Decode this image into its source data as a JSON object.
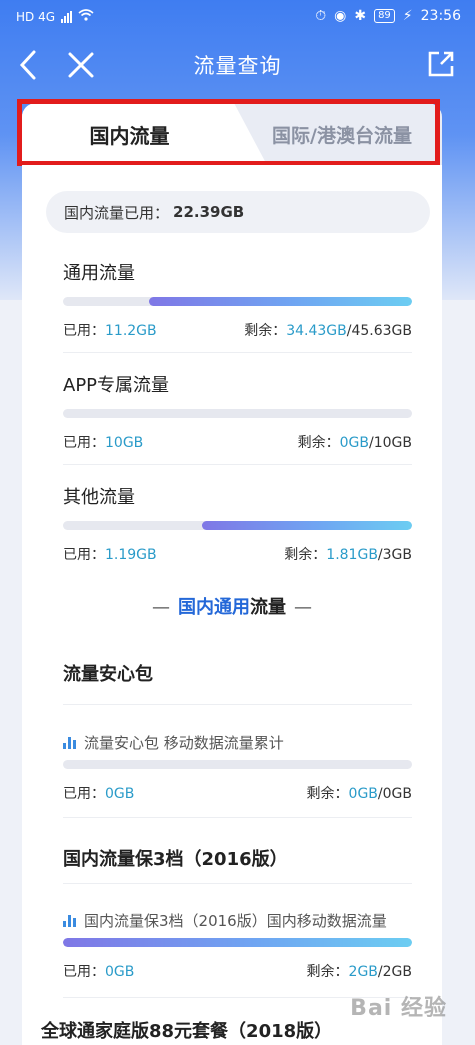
{
  "statusbar": {
    "network": "HD 4G",
    "battery": "89",
    "time": "23:56"
  },
  "nav": {
    "title": "流量查询"
  },
  "tabs": {
    "active": "国内流量",
    "inactive": "国际/港澳台流量"
  },
  "summary": {
    "label": "国内流量已用：",
    "value": "22.39GB"
  },
  "usage": [
    {
      "title": "通用流量",
      "used_label": "已用：",
      "used": "11.2GB",
      "remain_label": "剩余：",
      "remain": "34.43GB",
      "total": "/45.63GB",
      "remaining_fraction": 0.755
    },
    {
      "title": "APP专属流量",
      "used_label": "已用：",
      "used": "10GB",
      "remain_label": "剩余：",
      "remain": "0GB",
      "total": "/10GB",
      "remaining_fraction": 0.0
    },
    {
      "title": "其他流量",
      "used_label": "已用：",
      "used": "1.19GB",
      "remain_label": "剩余：",
      "remain": "1.81GB",
      "total": "/3GB",
      "remaining_fraction": 0.603
    }
  ],
  "center_heading": {
    "dash_left": "—",
    "blue": "国内通用",
    "black": "流量",
    "dash_right": "—"
  },
  "packs": [
    {
      "title": "流量安心包",
      "desc": "流量安心包 移动数据流量累计",
      "used_label": "已用：",
      "used": "0GB",
      "remain_label": "剩余：",
      "remain": "0GB",
      "total": "/0GB",
      "remaining_fraction": 0.0
    },
    {
      "title": "国内流量保3档（2016版）",
      "desc": "国内流量保3档（2016版）国内移动数据流量",
      "used_label": "已用：",
      "used": "0GB",
      "remain_label": "剩余：",
      "remain": "2GB",
      "total": "/2GB",
      "remaining_fraction": 1.0
    }
  ],
  "bottom_peek": "全球通家庭版88元套餐（2018版）",
  "watermark": "Bai 经验",
  "colors": {
    "accent": "#3f7df1",
    "value_blue": "#2a9bc9",
    "heading_blue": "#2468d8",
    "highlight_red": "#e21c1c"
  }
}
